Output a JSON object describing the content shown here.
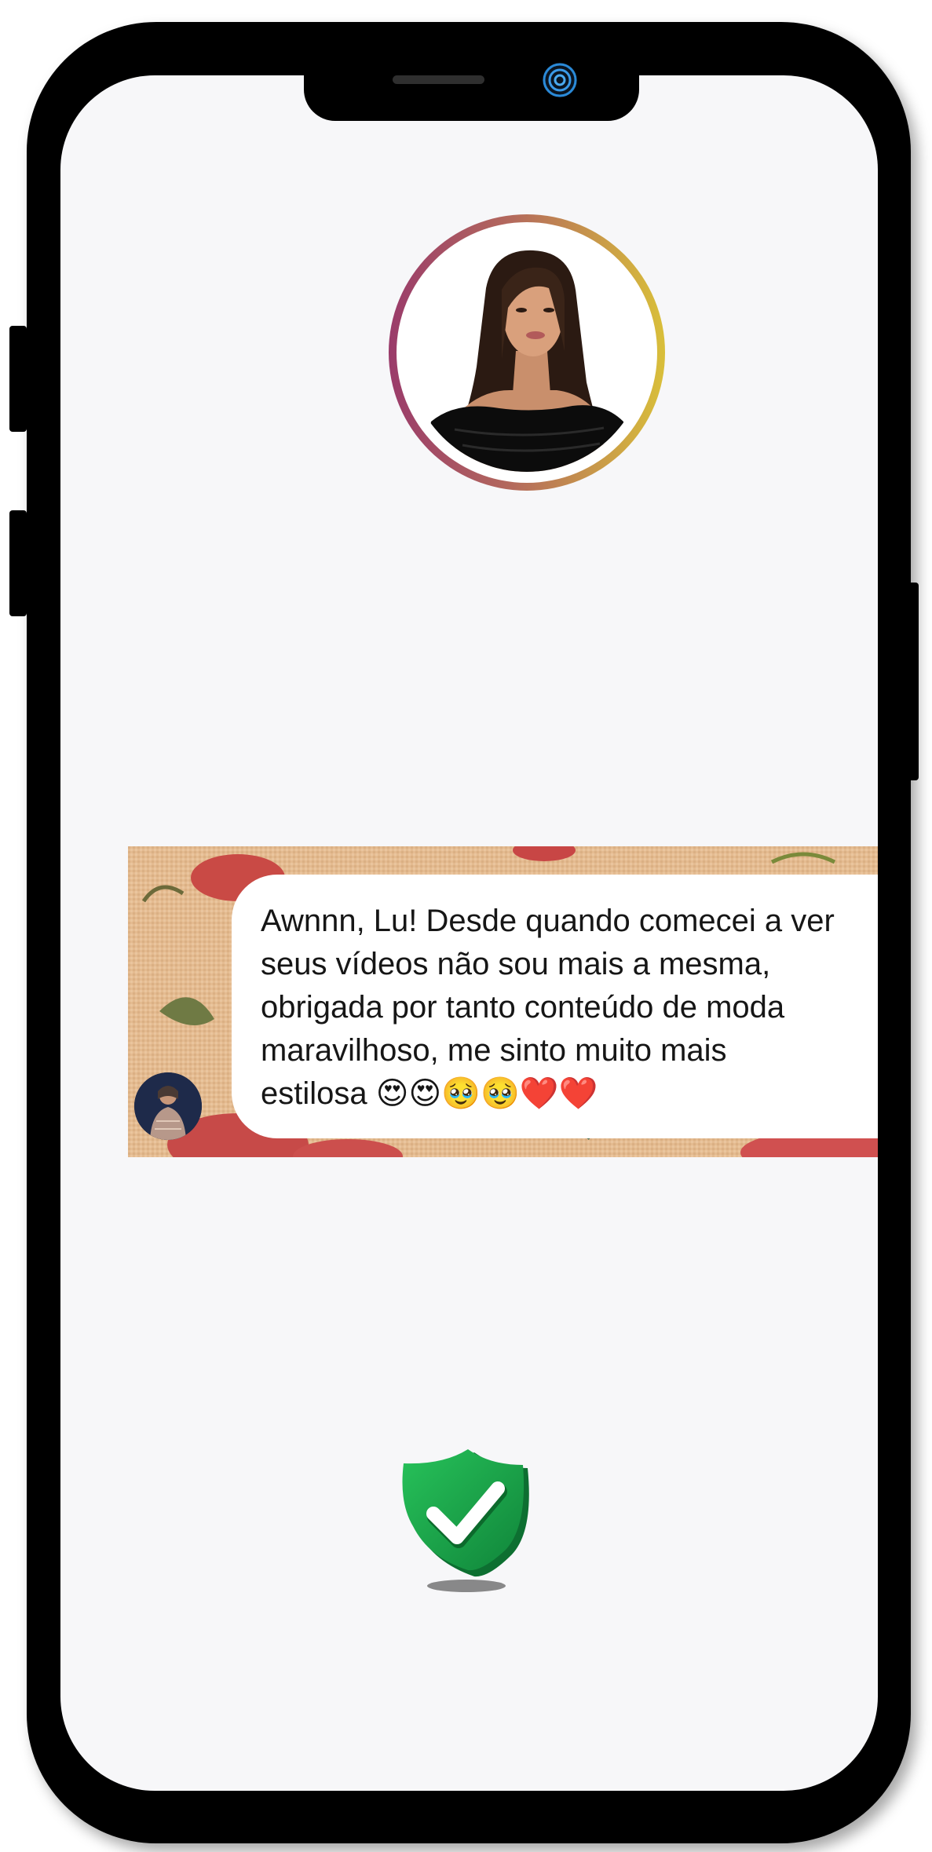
{
  "profile": {
    "icon": "profile-photo"
  },
  "comment": {
    "text": "Awnnn, Lu! Desde quando comecei a ver\nseus vídeos não sou mais a mesma,\nobrigada por tanto conteúdo de moda\nmaravilhoso, me sinto muito mais\nestilosa 😍😍🥹🥹❤️❤️"
  },
  "verified": {
    "icon": "check-shield-icon"
  },
  "colors": {
    "screen": "#f7f7f9",
    "frame": "#000000",
    "ring_start": "#9a3b6a",
    "ring_end": "#d9bf3a",
    "shield": "#1fa84a"
  }
}
